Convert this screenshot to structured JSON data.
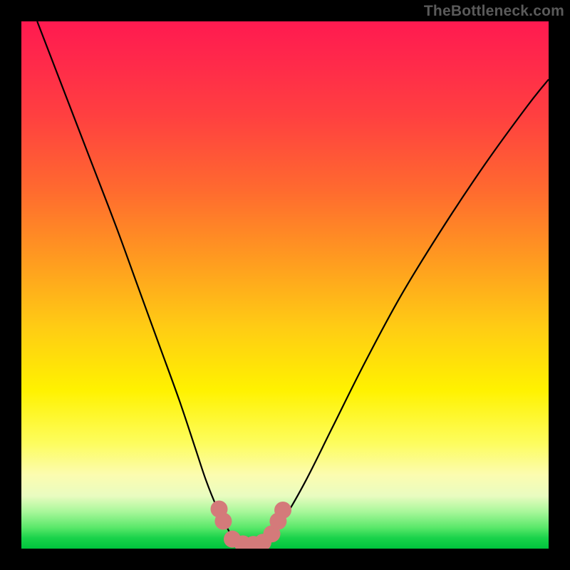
{
  "watermark": "TheBottleneck.com",
  "chart_data": {
    "type": "line",
    "title": "",
    "xlabel": "",
    "ylabel": "",
    "xlim": [
      0,
      100
    ],
    "ylim": [
      0,
      100
    ],
    "grid": false,
    "legend": false,
    "series": [
      {
        "name": "left-curve",
        "x": [
          3,
          8,
          13,
          18,
          22,
          26,
          30,
          33,
          35,
          37,
          39,
          40.5,
          42
        ],
        "y": [
          100,
          87,
          74,
          61,
          50,
          39,
          28,
          19,
          13,
          8,
          4,
          1.5,
          0.5
        ]
      },
      {
        "name": "right-curve",
        "x": [
          45,
          47,
          50,
          54,
          59,
          65,
          72,
          80,
          88,
          96,
          100
        ],
        "y": [
          0.5,
          2,
          6,
          13,
          23,
          35,
          48,
          61,
          73,
          84,
          89
        ]
      }
    ],
    "markers": {
      "name": "bottom-dots",
      "color": "#d47a7a",
      "radius": 12,
      "points": [
        {
          "x": 37.5,
          "y": 7.5
        },
        {
          "x": 38.3,
          "y": 5.2
        },
        {
          "x": 40.0,
          "y": 1.8
        },
        {
          "x": 42.0,
          "y": 0.9
        },
        {
          "x": 44.0,
          "y": 0.8
        },
        {
          "x": 45.8,
          "y": 1.2
        },
        {
          "x": 47.5,
          "y": 2.8
        },
        {
          "x": 48.7,
          "y": 5.2
        },
        {
          "x": 49.6,
          "y": 7.3
        }
      ]
    },
    "background_gradient_stops": [
      {
        "offset": 0.0,
        "color": "#ff1a50"
      },
      {
        "offset": 0.7,
        "color": "#fff200"
      },
      {
        "offset": 1.0,
        "color": "#00c43d"
      }
    ]
  }
}
